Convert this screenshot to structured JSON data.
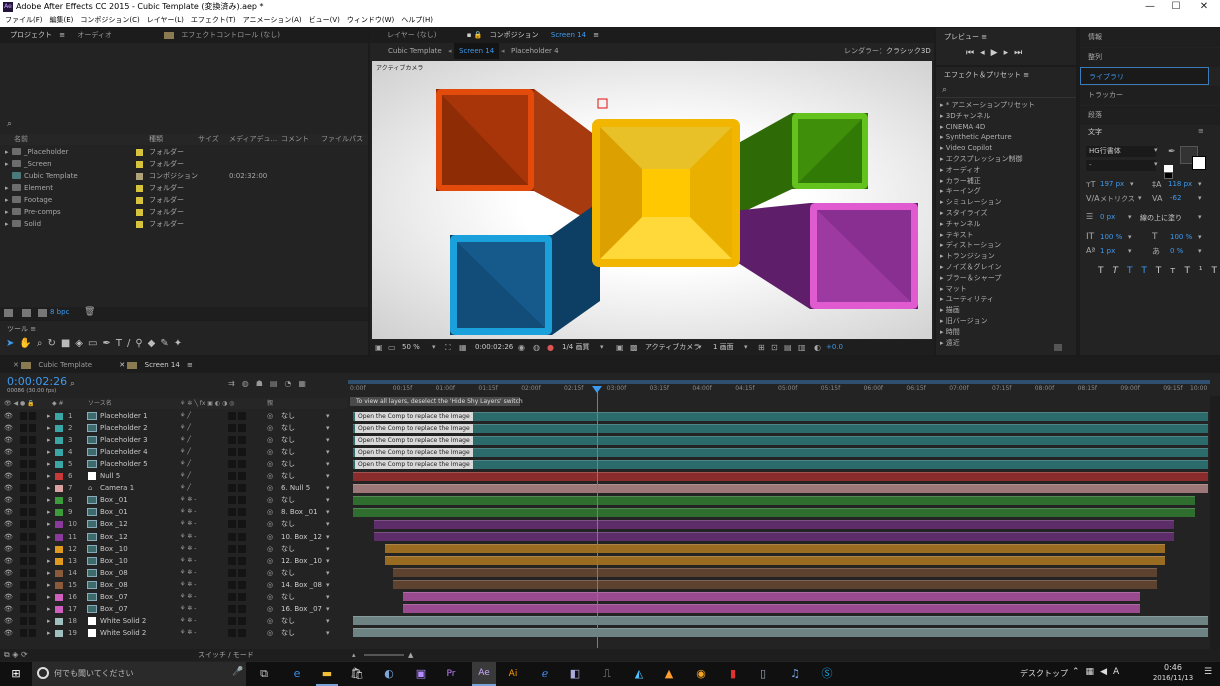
{
  "app": {
    "title": "Adobe After Effects CC 2015 - Cubic Template (変換済み).aep *",
    "minimize": "—",
    "maximize": "☐",
    "close": "✕"
  },
  "menu": [
    "ファイル(F)",
    "編集(E)",
    "コンポジション(C)",
    "レイヤー(L)",
    "エフェクト(T)",
    "アニメーション(A)",
    "ビュー(V)",
    "ウィンドウ(W)",
    "ヘルプ(H)"
  ],
  "project": {
    "tabs": [
      "プロジェクト",
      "オーディオ",
      "エフェクトコントロール (なし)"
    ],
    "columns": [
      "名前",
      "種類",
      "サイズ",
      "メディアデュ...",
      "コメント",
      "ファイルパス"
    ],
    "items": [
      {
        "name": "_Placeholder",
        "type": "フォルダー",
        "size": "",
        "color": "#d6c43c"
      },
      {
        "name": "_Screen",
        "type": "フォルダー",
        "size": "",
        "color": "#d6c43c"
      },
      {
        "name": "Cubic Template",
        "type": "コンポジション",
        "size": "0:02:32:00",
        "color": "#b0a37a"
      },
      {
        "name": "Element",
        "type": "フォルダー",
        "size": "",
        "color": "#d6c43c"
      },
      {
        "name": "Footage",
        "type": "フォルダー",
        "size": "",
        "color": "#d6c43c"
      },
      {
        "name": "Pre-comps",
        "type": "フォルダー",
        "size": "",
        "color": "#d6c43c"
      },
      {
        "name": "Solid",
        "type": "フォルダー",
        "size": "",
        "color": "#d6c43c"
      }
    ],
    "bpc": "8 bpc"
  },
  "tools": {
    "label": "ツール"
  },
  "comp": {
    "tabs": [
      "レイヤー (なし)",
      "コンポジション",
      "Screen 14"
    ],
    "breadcrumbs": [
      "Cubic Template",
      "Screen 14",
      "Placeholder 4"
    ],
    "renderer_label": "レンダラー：",
    "renderer": "クラシック3D",
    "camera_label": "アクティブカメラ",
    "zoom": "50 %",
    "timecode": "0:00:02:26",
    "resolution": "1/4 画質",
    "view_camera": "アクティブカメラ",
    "views": "1 画面",
    "exposure": "+0.0"
  },
  "preview": {
    "title": "プレビュー"
  },
  "effects": {
    "title": "エフェクト＆プリセット",
    "items": [
      "* アニメーションプリセット",
      "3Dチャンネル",
      "CINEMA 4D",
      "Synthetic Aperture",
      "Video Copilot",
      "エクスプレッション制御",
      "オーディオ",
      "カラー補正",
      "キーイング",
      "シミュレーション",
      "スタイライズ",
      "チャンネル",
      "テキスト",
      "ディストーション",
      "トランジション",
      "ノイズ＆グレイン",
      "ブラー＆シャープ",
      "マット",
      "ユーティリティ",
      "描画",
      "旧バージョン",
      "時間",
      "遠近"
    ]
  },
  "right_tabs": [
    "情報",
    "整列",
    "ライブラリ",
    "トラッカー",
    "段落"
  ],
  "character": {
    "title": "文字",
    "font": "HG行書体",
    "style": "-",
    "size": "197 px",
    "leading": "118 px",
    "kerning": "メトリクス",
    "tracking": "-62",
    "stroke": "0 px",
    "stroke_mode": "線の上に塗り",
    "vscale": "100 %",
    "hscale": "100 %",
    "baseline": "1 px",
    "tsume": "0 %"
  },
  "timeline": {
    "tabs": [
      "Cubic Template",
      "Screen 14"
    ],
    "timecode": "0:00:02:26",
    "fps": "00086 (30.00 fps)",
    "col_source": "ソース名",
    "col_parent": "親",
    "ruler": [
      "0:00f",
      "00:15f",
      "01:00f",
      "01:15f",
      "02:00f",
      "02:15f",
      "03:00f",
      "03:15f",
      "04:00f",
      "04:15f",
      "05:00f",
      "05:15f",
      "06:00f",
      "06:15f",
      "07:00f",
      "07:15f",
      "08:00f",
      "08:15f",
      "09:00f",
      "09:15f",
      "10:00"
    ],
    "shy_note": "To view all layers, deselect the 'Hide Shy Layers' switch",
    "clip_note": "Open the Comp to replace the Image",
    "bottom": "スイッチ / モード",
    "layers": [
      {
        "n": "1",
        "name": "Placeholder 1",
        "parent": "なし",
        "label": "#3aa6a6",
        "bar": "#2b6b6b",
        "start": 0.0,
        "end": 1.0,
        "kind": "comp"
      },
      {
        "n": "2",
        "name": "Placeholder 2",
        "parent": "なし",
        "label": "#3aa6a6",
        "bar": "#2b6b6b",
        "start": 0.0,
        "end": 1.0,
        "kind": "comp"
      },
      {
        "n": "3",
        "name": "Placeholder 3",
        "parent": "なし",
        "label": "#3aa6a6",
        "bar": "#2b6b6b",
        "start": 0.0,
        "end": 1.0,
        "kind": "comp"
      },
      {
        "n": "4",
        "name": "Placeholder 4",
        "parent": "なし",
        "label": "#3aa6a6",
        "bar": "#2b6b6b",
        "start": 0.0,
        "end": 1.0,
        "kind": "comp"
      },
      {
        "n": "5",
        "name": "Placeholder 5",
        "parent": "なし",
        "label": "#3aa6a6",
        "bar": "#2b6b6b",
        "start": 0.0,
        "end": 1.0,
        "kind": "comp"
      },
      {
        "n": "6",
        "name": "Null 5",
        "parent": "なし",
        "label": "#c8393a",
        "bar": "#8a2c2c",
        "start": 0.0,
        "end": 1.0,
        "kind": "solid"
      },
      {
        "n": "7",
        "name": "Camera 1",
        "parent": "6. Null 5",
        "label": "#d8a0a0",
        "bar": "#9e7878",
        "start": 0.0,
        "end": 1.0,
        "kind": "cam"
      },
      {
        "n": "8",
        "name": "Box _01",
        "parent": "なし",
        "label": "#3c9c3c",
        "bar": "#2f6e2f",
        "start": 0.0,
        "end": 0.985,
        "kind": "comp"
      },
      {
        "n": "9",
        "name": "Box _01",
        "parent": "8. Box _01",
        "label": "#3c9c3c",
        "bar": "#2f6e2f",
        "start": 0.0,
        "end": 0.985,
        "kind": "comp"
      },
      {
        "n": "10",
        "name": "Box _12",
        "parent": "なし",
        "label": "#8a3a9a",
        "bar": "#5c2d68",
        "start": 0.025,
        "end": 0.96,
        "kind": "comp"
      },
      {
        "n": "11",
        "name": "Box _12",
        "parent": "10. Box _12",
        "label": "#8a3a9a",
        "bar": "#5c2d68",
        "start": 0.025,
        "end": 0.96,
        "kind": "comp"
      },
      {
        "n": "12",
        "name": "Box _10",
        "parent": "なし",
        "label": "#e09a20",
        "bar": "#9a6c22",
        "start": 0.037,
        "end": 0.95,
        "kind": "comp"
      },
      {
        "n": "13",
        "name": "Box _10",
        "parent": "12. Box _10",
        "label": "#e09a20",
        "bar": "#9a6c22",
        "start": 0.037,
        "end": 0.95,
        "kind": "comp"
      },
      {
        "n": "14",
        "name": "Box _08",
        "parent": "なし",
        "label": "#8a5a3a",
        "bar": "#5e4230",
        "start": 0.047,
        "end": 0.94,
        "kind": "comp"
      },
      {
        "n": "15",
        "name": "Box _08",
        "parent": "14. Box _08",
        "label": "#8a5a3a",
        "bar": "#5e4230",
        "start": 0.047,
        "end": 0.94,
        "kind": "comp"
      },
      {
        "n": "16",
        "name": "Box _07",
        "parent": "なし",
        "label": "#d060c0",
        "bar": "#9a4a8e",
        "start": 0.058,
        "end": 0.92,
        "kind": "comp"
      },
      {
        "n": "17",
        "name": "Box _07",
        "parent": "16. Box _07",
        "label": "#d060c0",
        "bar": "#9a4a8e",
        "start": 0.058,
        "end": 0.92,
        "kind": "comp"
      },
      {
        "n": "18",
        "name": "White Solid 2",
        "parent": "なし",
        "label": "#a0c0c0",
        "bar": "#6e8484",
        "start": 0.0,
        "end": 1.0,
        "kind": "solid"
      },
      {
        "n": "19",
        "name": "White Solid 2",
        "parent": "なし",
        "label": "#a0c0c0",
        "bar": "#6e8484",
        "start": 0.0,
        "end": 1.0,
        "kind": "solid"
      }
    ]
  },
  "taskbar": {
    "search": "何でも聞いてください",
    "desktop": "デスクトップ",
    "ime": "A",
    "time": "0:46",
    "date": "2016/11/13"
  }
}
